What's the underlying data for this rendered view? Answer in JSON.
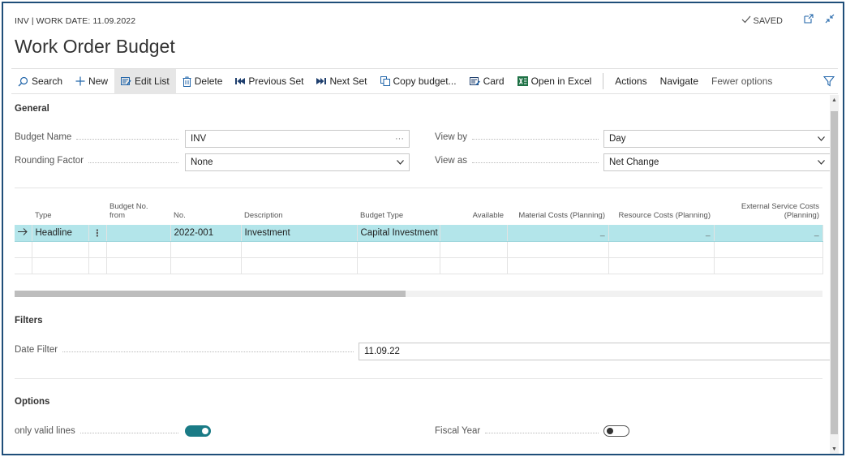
{
  "header": {
    "context": "INV | WORK DATE: 11.09.2022",
    "saved_label": "SAVED",
    "page_title": "Work Order Budget"
  },
  "actions": {
    "search": "Search",
    "new": "New",
    "edit_list": "Edit List",
    "delete": "Delete",
    "previous_set": "Previous Set",
    "next_set": "Next Set",
    "copy_budget": "Copy budget...",
    "card": "Card",
    "open_in_excel": "Open in Excel",
    "actions_menu": "Actions",
    "navigate": "Navigate",
    "fewer_options": "Fewer options"
  },
  "general": {
    "section_title": "General",
    "budget_name": {
      "label": "Budget Name",
      "value": "INV"
    },
    "rounding_factor": {
      "label": "Rounding Factor",
      "value": "None"
    },
    "view_by": {
      "label": "View by",
      "value": "Day"
    },
    "view_as": {
      "label": "View as",
      "value": "Net Change"
    }
  },
  "grid": {
    "columns": {
      "type": "Type",
      "budget_no_from_1": "Budget No.",
      "budget_no_from_2": "from",
      "no": "No.",
      "description": "Description",
      "budget_type": "Budget Type",
      "available": "Available",
      "material_costs": "Material Costs (Planning)",
      "resource_costs": "Resource Costs (Planning)",
      "external_service_1": "External Service Costs",
      "external_service_2": "(Planning)"
    },
    "rows": [
      {
        "type": "Headline",
        "budget_no_from": "",
        "no": "2022-001",
        "description": "Investment",
        "budget_type": "Capital Investment",
        "available": "",
        "material_costs": "_",
        "resource_costs": "_",
        "external_service_costs": "_"
      }
    ]
  },
  "filters": {
    "section_title": "Filters",
    "date_filter": {
      "label": "Date Filter",
      "value": "11.09.22"
    }
  },
  "options": {
    "section_title": "Options",
    "only_valid_lines": {
      "label": "only valid lines",
      "value": true
    },
    "fiscal_year": {
      "label": "Fiscal Year",
      "value": false
    }
  },
  "colors": {
    "accent": "#1a7b86",
    "selected_row": "#b3e5ea",
    "frame_border": "#1f4e79",
    "excel_green": "#1e7145",
    "link_blue": "#2266aa"
  }
}
